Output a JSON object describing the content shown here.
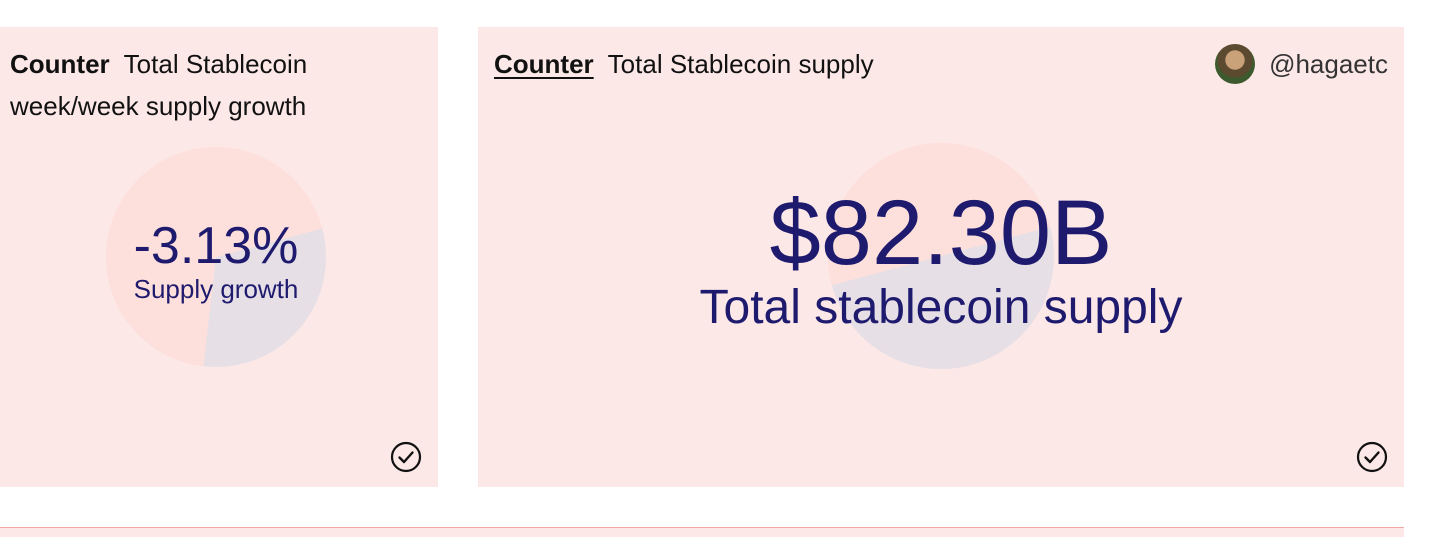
{
  "left_card": {
    "viz_type": "Counter",
    "title": "Total Stablecoin week/week supply growth",
    "value": "-3.13%",
    "label": "Supply growth",
    "pie_fill_percent": 0.31,
    "icon": "check-circle-icon"
  },
  "right_card": {
    "viz_type": "Counter",
    "title": "Total Stablecoin supply",
    "author": "@hagaetc",
    "value": "$82.30B",
    "label": "Total stablecoin supply",
    "pie_fill_percent": 0.5,
    "icon": "check-circle-icon"
  },
  "colors": {
    "card_background": "#fde8e8",
    "pie_primary": "#fddfdb",
    "pie_secondary": "#e6dfe6",
    "metric_text": "#1e1b6e",
    "bottom_border": "#f2a6a6"
  }
}
